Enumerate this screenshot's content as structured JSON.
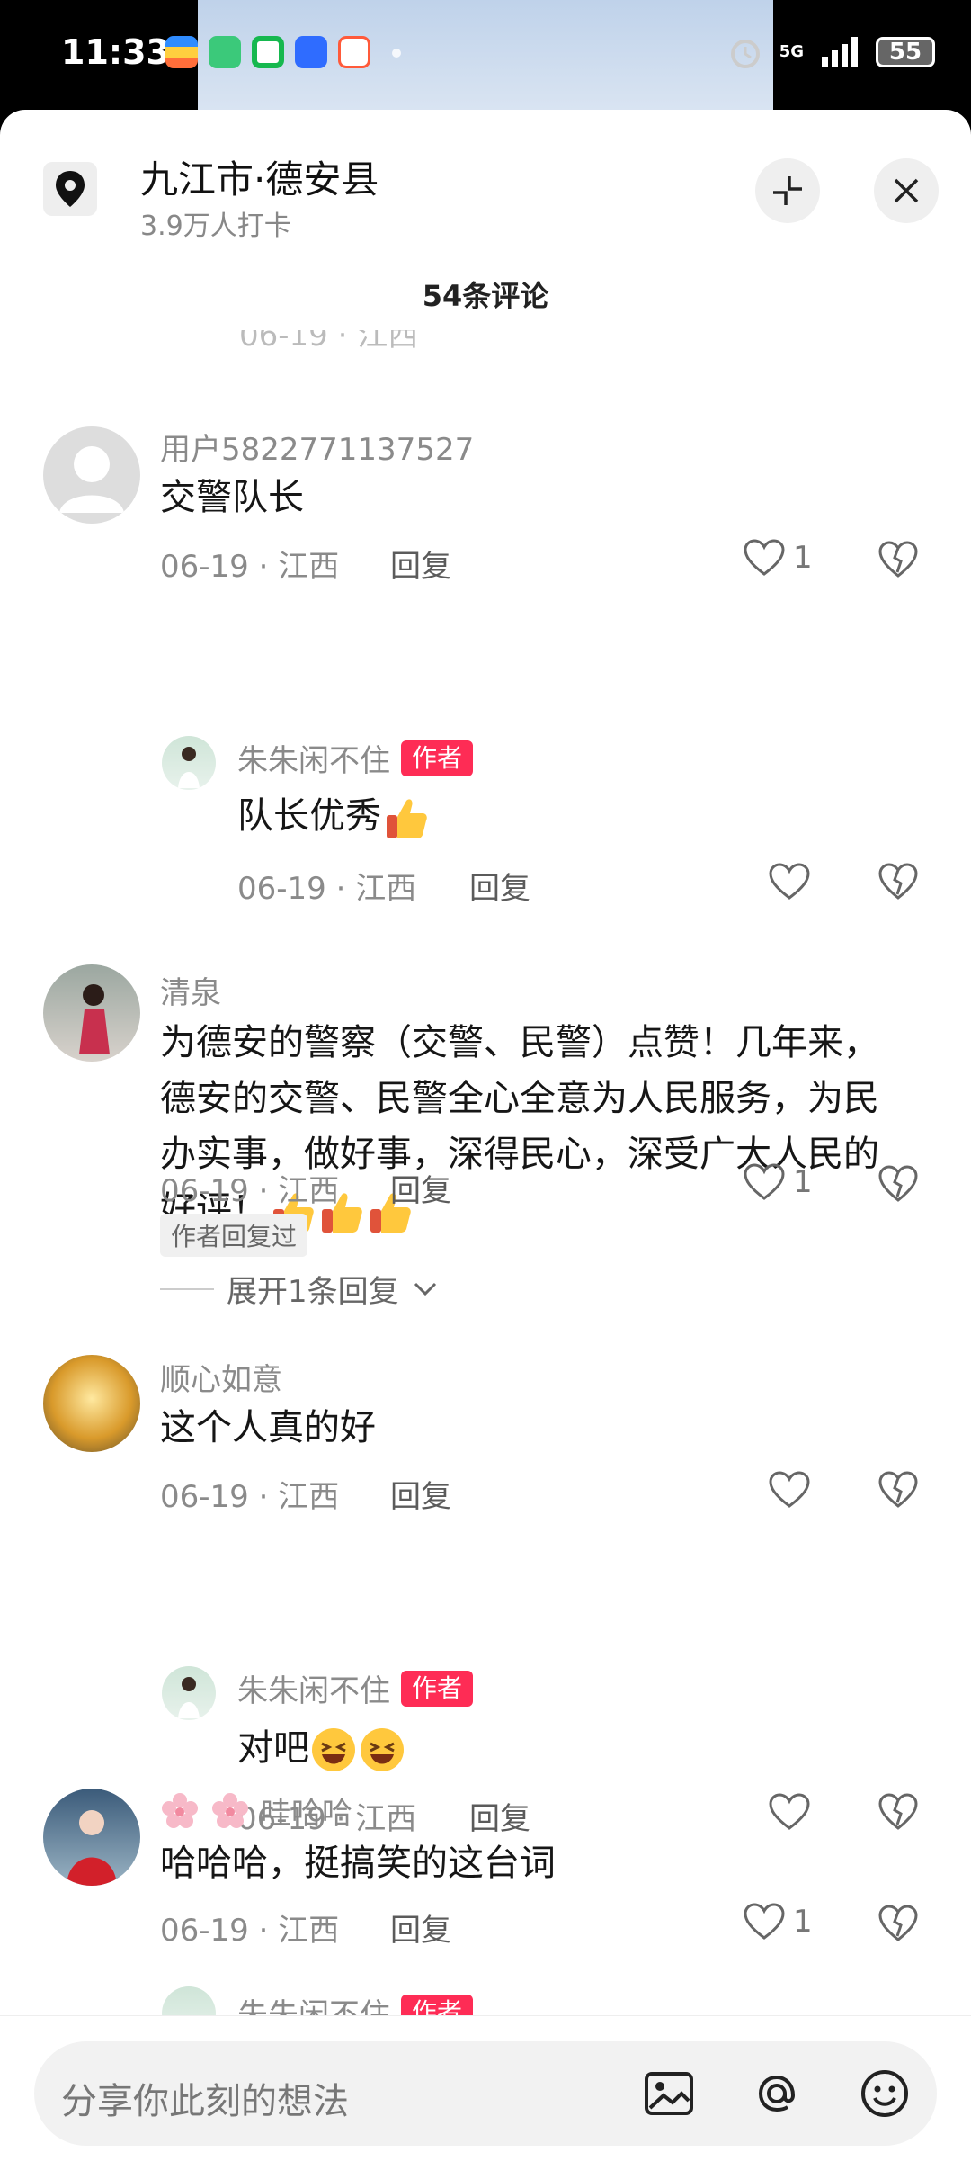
{
  "status": {
    "time": "11:33",
    "network": "5G",
    "battery": "55"
  },
  "location": {
    "title": "九江市·德安县",
    "subtitle": "3.9万人打卡"
  },
  "comments_header": "54条评论",
  "author_label": "作者",
  "reply_label": "回复",
  "comments": [
    {
      "user": "用户5822771137527",
      "text": "交警队长",
      "meta": "06-19 · 江西",
      "likes": "1"
    },
    {
      "user": "朱朱闲不住",
      "text": "队长优秀",
      "meta": "06-19 · 江西",
      "likes": ""
    },
    {
      "user": "清泉",
      "text": "为德安的警察（交警、民警）点赞！几年来，德安的交警、民警全心全意为人民服务，为民办实事，做好事，深得民心，深受广大人民的好评！",
      "meta": "06-19 · 江西",
      "likes": "1"
    },
    {
      "user": "顺心如意",
      "text": "这个人真的好",
      "meta": "06-19 · 江西",
      "likes": ""
    },
    {
      "user": "朱朱闲不住",
      "text": "对吧",
      "meta": "06-19 · 江西",
      "likes": ""
    },
    {
      "user": "哇哈哈",
      "text": "哈哈哈，挺搞笑的这台词",
      "meta": "06-19 · 江西",
      "likes": "1"
    },
    {
      "user": "朱朱闲不住",
      "text": "",
      "meta": "",
      "likes": ""
    }
  ],
  "replied_tag": "作者回复过",
  "expand_label": "展开1条回复",
  "input_placeholder": "分享你此刻的想法",
  "icons": [
    "location-pin-icon",
    "collapse-icon",
    "close-icon",
    "heart-icon",
    "broken-heart-icon",
    "image-icon",
    "at-icon",
    "emoji-icon"
  ]
}
